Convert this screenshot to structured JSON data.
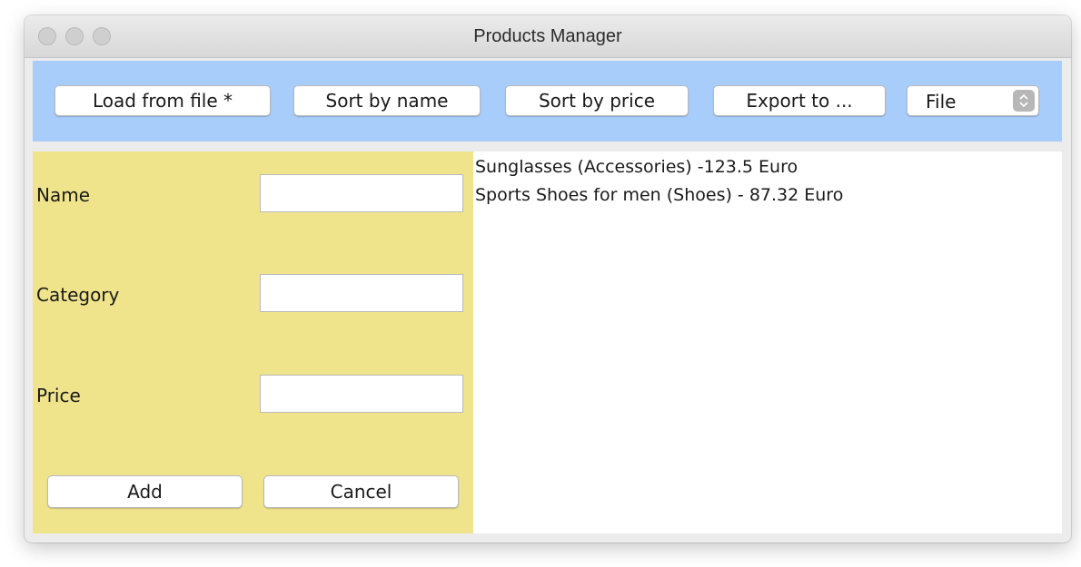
{
  "window": {
    "title": "Products Manager"
  },
  "toolbar": {
    "load_label": "Load from file *",
    "sort_name_label": "Sort by name",
    "sort_price_label": "Sort by price",
    "export_label": "Export to ...",
    "format_select": {
      "selected": "File"
    }
  },
  "form": {
    "name_label": "Name",
    "category_label": "Category",
    "price_label": "Price",
    "name_value": "",
    "category_value": "",
    "price_value": "",
    "add_label": "Add",
    "cancel_label": "Cancel"
  },
  "products": [
    "Sunglasses (Accessories) -123.5 Euro",
    "Sports Shoes for men (Shoes) - 87.32 Euro"
  ],
  "colors": {
    "toolbar_bg": "#a8cdfa",
    "form_bg": "#efe48c",
    "list_bg": "#ffffff"
  },
  "icons": {
    "window_controls": [
      "close-icon",
      "minimize-icon",
      "zoom-icon"
    ],
    "select_arrows": "up-down-chevron-icon"
  }
}
